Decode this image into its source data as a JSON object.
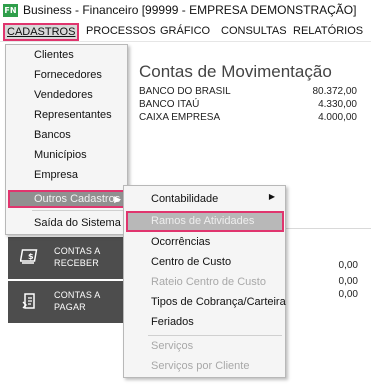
{
  "window": {
    "app_icon_text": "FN",
    "title": "Business - Financeiro  [99999 - EMPRESA DEMONSTRAÇÃO]"
  },
  "menubar": {
    "items": [
      {
        "label": "CADASTROS"
      },
      {
        "label": "PROCESSOS"
      },
      {
        "label": "GRÁFICO"
      },
      {
        "label": "CONSULTAS"
      },
      {
        "label": "RELATÓRIOS"
      }
    ]
  },
  "accounts": {
    "title": "Contas de Movimentação",
    "rows": [
      {
        "name": "BANCO DO BRASIL",
        "amount": "80.372,00"
      },
      {
        "name": "BANCO ITAÚ",
        "amount": "4.330,00"
      },
      {
        "name": "CAIXA EMPRESA",
        "amount": "4.000,00"
      }
    ]
  },
  "summary_values": [
    "0,00",
    "0,00",
    "0,00"
  ],
  "tiles": [
    {
      "line1": "CONTAS A",
      "line2": "RECEBER"
    },
    {
      "line1": "CONTAS A",
      "line2": "PAGAR"
    }
  ],
  "cadastros_menu": {
    "items": [
      {
        "label": "Clientes"
      },
      {
        "label": "Fornecedores"
      },
      {
        "label": "Vendedores"
      },
      {
        "label": "Representantes"
      },
      {
        "label": "Bancos"
      },
      {
        "label": "Municípios"
      },
      {
        "label": "Empresa"
      },
      {
        "label": "Outros Cadastros"
      },
      {
        "label": "Saída do Sistema"
      }
    ]
  },
  "outros_submenu": {
    "items": [
      {
        "label": "Contabilidade",
        "enabled": true
      },
      {
        "label": "Ramos de Atividades",
        "enabled": true
      },
      {
        "label": "Ocorrências",
        "enabled": true
      },
      {
        "label": "Centro de Custo",
        "enabled": true
      },
      {
        "label": "Rateio Centro de Custo",
        "enabled": false
      },
      {
        "label": "Tipos de Cobrança/Carteira",
        "enabled": true
      },
      {
        "label": "Feriados",
        "enabled": true
      },
      {
        "label": "Serviços",
        "enabled": false
      },
      {
        "label": "Serviços por Cliente",
        "enabled": false
      }
    ]
  },
  "colors": {
    "highlight_border": "#e0356e",
    "tile_background": "#4d4d4d",
    "app_icon": "#2f9e4a"
  }
}
